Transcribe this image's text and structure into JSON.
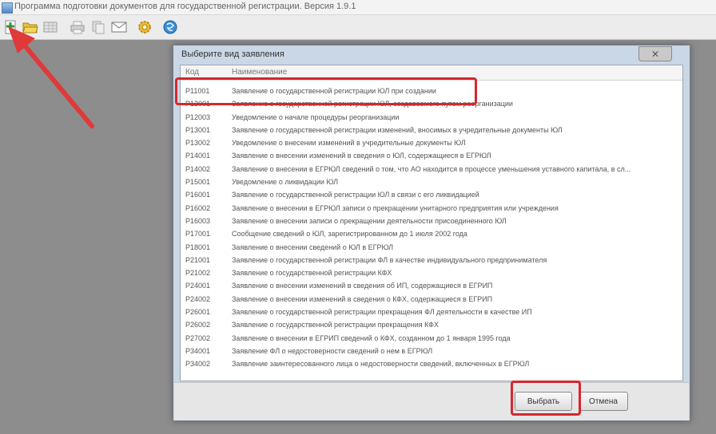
{
  "window": {
    "title": "Программа подготовки документов для государственной регистрации. Версия 1.9.1"
  },
  "toolbar": {
    "icons": [
      "new-document-icon",
      "open-folder-icon",
      "table-icon",
      "print-icon",
      "copy-icon",
      "envelope-icon",
      "settings-gear-icon",
      "help-globe-icon"
    ]
  },
  "dialog": {
    "title": "Выберите вид заявления",
    "close_glyph": "✕",
    "columns": {
      "code": "Код",
      "name": "Наименование"
    },
    "rows": [
      {
        "code": "Р11001",
        "name": "Заявление о государственной регистрации ЮЛ при создании"
      },
      {
        "code": "Р12001",
        "name": "Заявление о государственной регистрации ЮЛ, создаваемого путем реорганизации"
      },
      {
        "code": "Р12003",
        "name": "Уведомление о начале процедуры реорганизации"
      },
      {
        "code": "Р13001",
        "name": "Заявление о государственной регистрации изменений, вносимых в учредительные документы ЮЛ"
      },
      {
        "code": "Р13002",
        "name": "Уведомление о внесении изменений в учредительные документы ЮЛ"
      },
      {
        "code": "Р14001",
        "name": "Заявление о внесении изменений в сведения о ЮЛ, содержащиеся в ЕГРЮЛ"
      },
      {
        "code": "Р14002",
        "name": "Заявление о внесении в ЕГРЮЛ сведений о том, что АО находится в процессе уменьшения уставного капитала, в сл..."
      },
      {
        "code": "Р15001",
        "name": "Уведомление о ликвидации ЮЛ"
      },
      {
        "code": "Р16001",
        "name": "Заявление о государственной регистрации ЮЛ в связи с его ликвидацией"
      },
      {
        "code": "Р16002",
        "name": "Заявление о внесении в ЕГРЮЛ записи о прекращении унитарного предприятия или учреждения"
      },
      {
        "code": "Р16003",
        "name": "Заявление о внесении записи о прекращении деятельности присоединенного ЮЛ"
      },
      {
        "code": "Р17001",
        "name": "Сообщение сведений о ЮЛ, зарегистрированном до 1 июля 2002 года"
      },
      {
        "code": "Р18001",
        "name": "Заявление о внесении сведений о ЮЛ в ЕГРЮЛ"
      },
      {
        "code": "Р21001",
        "name": "Заявление о государственной регистрации ФЛ в качестве индивидуального предпринимателя"
      },
      {
        "code": "Р21002",
        "name": "Заявление о государственной регистрации КФХ"
      },
      {
        "code": "Р24001",
        "name": "Заявление о внесении изменений в сведения об ИП, содержащиеся в ЕГРИП"
      },
      {
        "code": "Р24002",
        "name": "Заявление о внесении изменений в сведения о КФХ, содержащиеся в ЕГРИП"
      },
      {
        "code": "Р26001",
        "name": "Заявление о государственной регистрации прекращения ФЛ деятельности в качестве ИП"
      },
      {
        "code": "Р26002",
        "name": "Заявление о государственной регистрации прекращения КФХ"
      },
      {
        "code": "Р27002",
        "name": "Заявление о внесении в ЕГРИП сведений о КФХ, созданном до 1 января 1995 года"
      },
      {
        "code": "Р34001",
        "name": "Заявление ФЛ о недостоверности сведений о нем в ЕГРЮЛ"
      },
      {
        "code": "Р34002",
        "name": "Заявление заинтересованного лица о недостоверности сведений, включенных в ЕГРЮЛ"
      }
    ],
    "buttons": {
      "select": "Выбрать",
      "cancel": "Отмена"
    }
  },
  "highlight_color": "#d4282e"
}
